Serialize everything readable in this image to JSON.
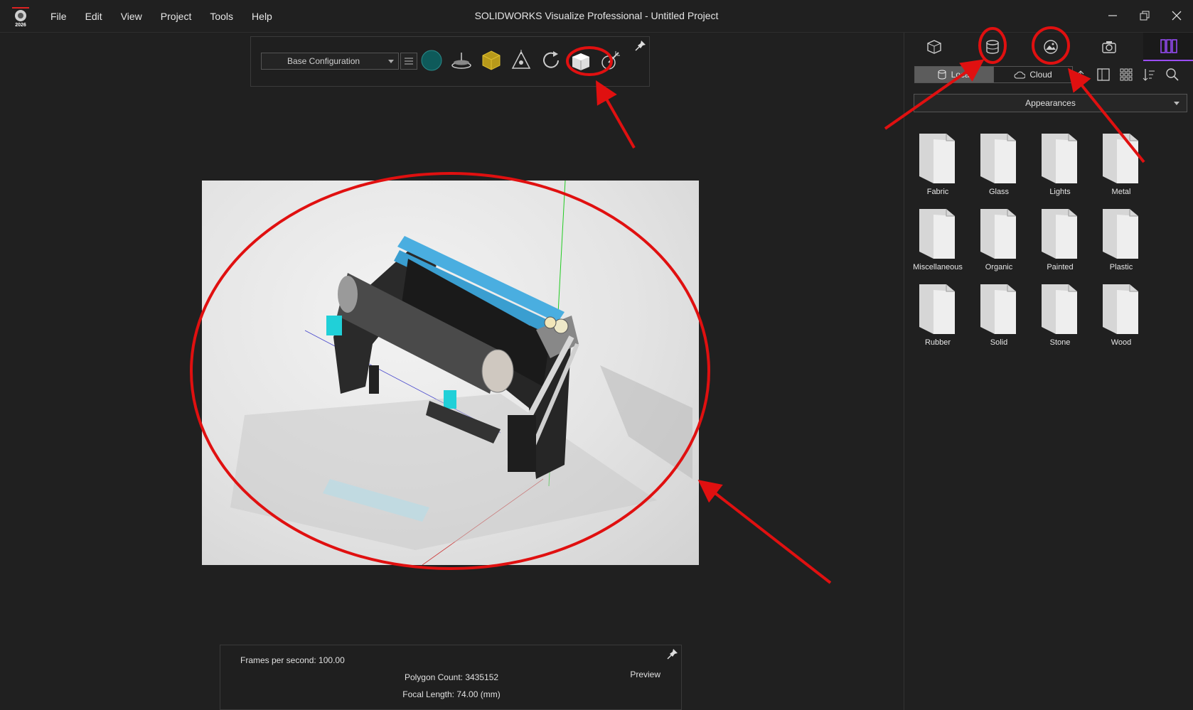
{
  "app": {
    "logo_year": "2026",
    "window_title": "SOLIDWORKS Visualize Professional - Untitled Project"
  },
  "menu": [
    "File",
    "Edit",
    "View",
    "Project",
    "Tools",
    "Help"
  ],
  "toolbar": {
    "configuration": "Base Configuration"
  },
  "status": {
    "fps": "Frames per second: 100.00",
    "polygon_count": "Polygon Count: 3435152",
    "focal_length": "Focal Length: 74.00 (mm)",
    "render_mode": "Preview"
  },
  "panel": {
    "tabs": [
      "model-icon",
      "library-icon",
      "environment-icon",
      "camera-icon",
      "palette-icon"
    ],
    "active_tab": "palette-icon",
    "segments": [
      {
        "label": "Local",
        "active": true
      },
      {
        "label": "Cloud",
        "active": false
      }
    ],
    "library_select": "Appearances",
    "folders": [
      "Fabric",
      "Glass",
      "Lights",
      "Metal",
      "Miscellaneous",
      "Organic",
      "Painted",
      "Plastic",
      "Rubber",
      "Solid",
      "Stone",
      "Wood"
    ]
  },
  "colors": {
    "background": "#202020",
    "accent": "#9b4dff",
    "annotation": "#e01010"
  }
}
